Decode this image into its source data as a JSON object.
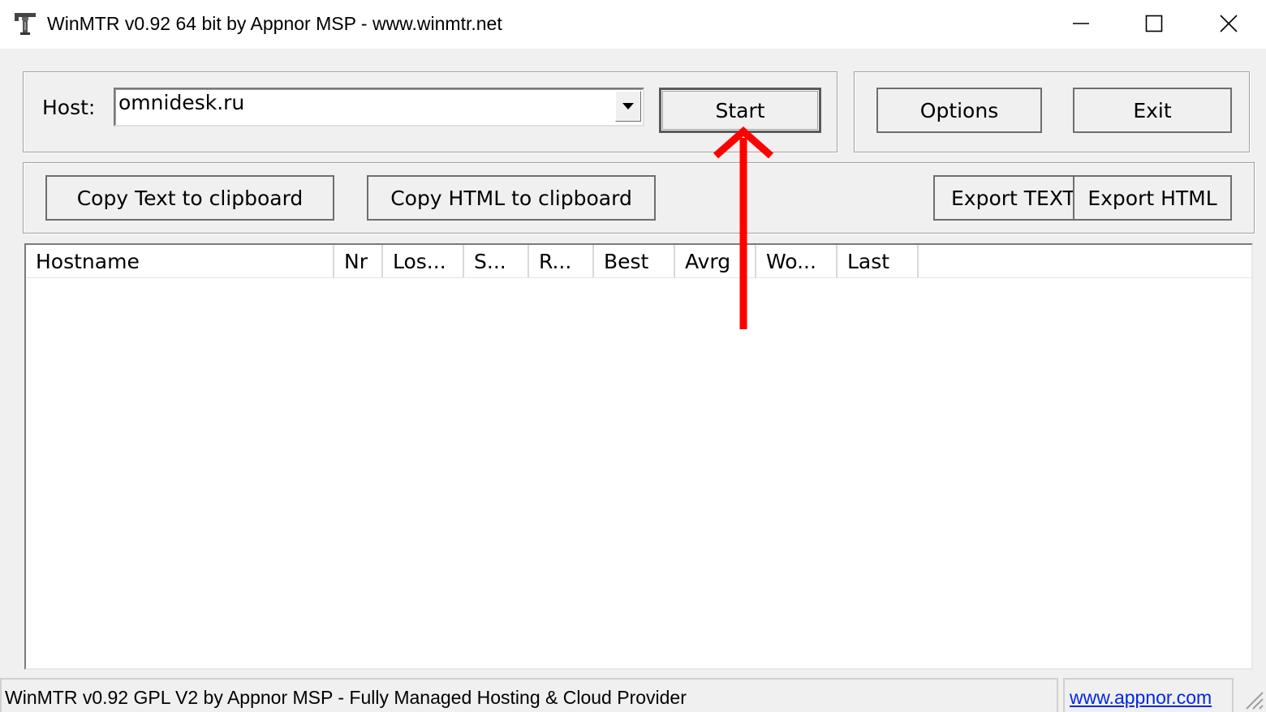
{
  "window": {
    "title": "WinMTR v0.92 64 bit by Appnor MSP - www.winmtr.net",
    "icon": "winmtr-app-icon"
  },
  "host": {
    "label": "Host:",
    "value": "omnidesk.ru"
  },
  "buttons": {
    "start": "Start",
    "options": "Options",
    "exit": "Exit",
    "copy_text": "Copy Text to clipboard",
    "copy_html": "Copy HTML to clipboard",
    "export_text": "Export TEXT",
    "export_html": "Export HTML"
  },
  "table": {
    "columns": [
      "Hostname",
      "Nr",
      "Los...",
      "S...",
      "R...",
      "Best",
      "Avrg",
      "Wo...",
      "Last"
    ],
    "rows": []
  },
  "statusbar": {
    "text": "WinMTR v0.92 GPL V2 by Appnor MSP - Fully Managed Hosting & Cloud Provider",
    "link": "www.appnor.com"
  },
  "colors": {
    "annotation_arrow": "#ff0000",
    "link": "#0026e6"
  }
}
